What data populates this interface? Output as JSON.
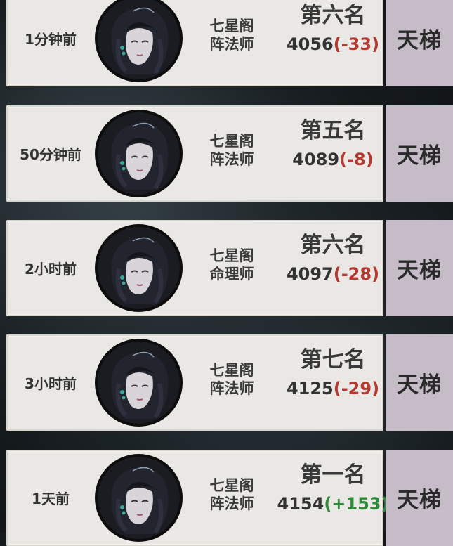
{
  "records": [
    {
      "time": "1分钟前",
      "sect": "七星阁",
      "role": "阵法师",
      "rank": "第六名",
      "score": "4056",
      "delta_open": "(",
      "delta": "-33",
      "delta_close": ")",
      "trend": "neg",
      "mode": "天梯"
    },
    {
      "time": "50分钟前",
      "sect": "七星阁",
      "role": "阵法师",
      "rank": "第五名",
      "score": "4089",
      "delta_open": "(",
      "delta": "-8",
      "delta_close": ")",
      "trend": "neg",
      "mode": "天梯"
    },
    {
      "time": "2小时前",
      "sect": "七星阁",
      "role": "命理师",
      "rank": "第六名",
      "score": "4097",
      "delta_open": "(",
      "delta": "-28",
      "delta_close": ")",
      "trend": "neg",
      "mode": "天梯"
    },
    {
      "time": "3小时前",
      "sect": "七星阁",
      "role": "阵法师",
      "rank": "第七名",
      "score": "4125",
      "delta_open": "(",
      "delta": "-29",
      "delta_close": ")",
      "trend": "neg",
      "mode": "天梯"
    },
    {
      "time": "1天前",
      "sect": "七星阁",
      "role": "阵法师",
      "rank": "第一名",
      "score": "4154",
      "delta_open": "(",
      "delta": "+153",
      "delta_close": ")",
      "trend": "pos",
      "mode": "天梯"
    }
  ],
  "colors": {
    "negative": "#b33a32",
    "positive": "#2f8a3a",
    "card": "#eae8e4",
    "side": "#c5bcc8"
  },
  "icons": {
    "avatar": "character-portrait-icon"
  }
}
